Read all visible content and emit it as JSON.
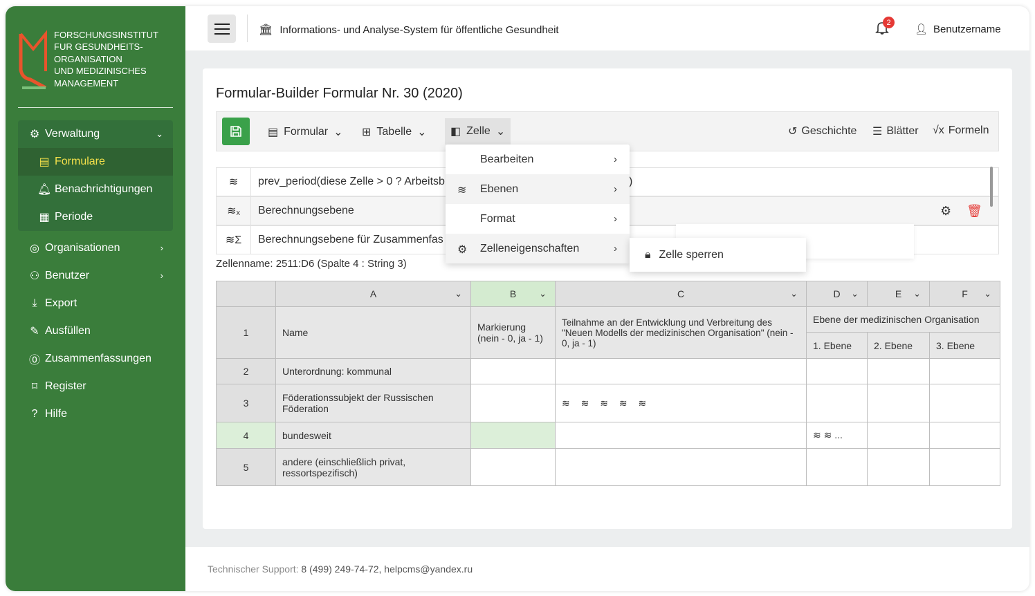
{
  "org": {
    "lines": [
      "FORSCHUNGSINSTITUT",
      "FUR GESUNDHEITS-",
      "ORGANISATION",
      "UND MEDIZINISCHES",
      "MANAGEMENT"
    ]
  },
  "sidebar": {
    "group": {
      "label": "Verwaltung",
      "items": [
        {
          "label": "Formulare"
        },
        {
          "label": "Benachrichtigungen"
        },
        {
          "label": "Periode"
        }
      ]
    },
    "items": [
      {
        "label": "Organisationen"
      },
      {
        "label": "Benutzer"
      },
      {
        "label": "Export"
      },
      {
        "label": "Ausfüllen"
      },
      {
        "label": "Zusammenfassungen"
      },
      {
        "label": "Register"
      },
      {
        "label": "Hilfe"
      }
    ]
  },
  "topbar": {
    "title": "Informations- und Analyse-System für öffentliche Gesundheit",
    "notifications": "2",
    "user": "Benutzername"
  },
  "page": {
    "title": "Formular-Builder Formular Nr. 30 (2020)"
  },
  "toolbar": {
    "formular": "Formular",
    "tabelle": "Tabelle",
    "zelle": "Zelle",
    "geschichte": "Geschichte",
    "blaetter": "Blätter",
    "formeln": "Formeln"
  },
  "layers": [
    {
      "text": "prev_period(diese Zelle > 0 ? Arbeitsb",
      "tail": ")"
    },
    {
      "text": "Berechnungsebene"
    },
    {
      "text": "Berechnungsebene für Zusammenfas"
    }
  ],
  "cellname": "Zellenname: 2511:D6 (Spalte 4 : String 3)",
  "menu": {
    "items": [
      {
        "label": "Bearbeiten"
      },
      {
        "label": "Ebenen"
      },
      {
        "label": "Format"
      },
      {
        "label": "Zelleneigenschaften"
      }
    ],
    "sub": "Zelle sperren"
  },
  "table": {
    "cols": [
      "A",
      "B",
      "C",
      "D",
      "E",
      "F"
    ],
    "header": {
      "num": "1",
      "name": "Name",
      "mark": "Markierung (nein - 0, ja - 1)",
      "part": "Teilnahme an der Entwicklung und Verbreitung des \"Neuen Modells der medizinischen Organisation\" (nein - 0, ja - 1)",
      "level": "Ebene der medizinischen Organisation",
      "l1": "1. Ebene",
      "l2": "2. Ebene",
      "l3": "3. Ebene"
    },
    "rows": [
      {
        "n": "2",
        "name": "Unterordnung: kommunal"
      },
      {
        "n": "3",
        "name": "Föderationssubjekt der Russischen Föderation"
      },
      {
        "n": "4",
        "name": "bundesweit",
        "more": "..."
      },
      {
        "n": "5",
        "name": "andere (einschließlich privat, ressortspezifisch)"
      }
    ]
  },
  "footer": {
    "label": "Technischer Support:",
    "value": "8 (499) 249-74-72, helpcms@yandex.ru"
  },
  "colors": {
    "sidebar": "#3a7d3b",
    "accent": "#3aa14a",
    "active": "#f3e04a",
    "danger": "#e53935"
  }
}
